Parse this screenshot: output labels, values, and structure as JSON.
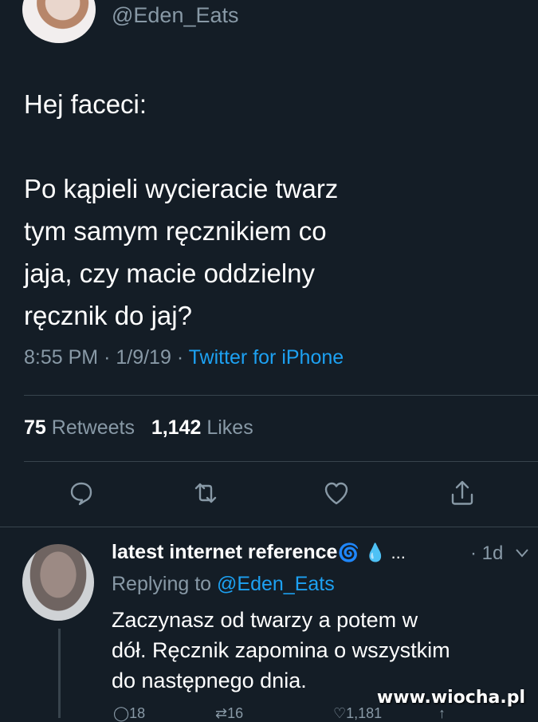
{
  "author": {
    "handle": "@Eden_Eats"
  },
  "tweet": {
    "lines": [
      "Hej faceci:",
      "",
      "Po kąpieli wycieracie twarz",
      "tym samym ręcznikiem co",
      "jaja, czy macie oddzielny",
      "ręcznik do jaj?"
    ],
    "time": "8:55 PM",
    "date": "1/9/19",
    "source": "Twitter for iPhone",
    "retweets_count": "75",
    "retweets_label": "Retweets",
    "likes_count": "1,142",
    "likes_label": "Likes"
  },
  "actions": {
    "icons": [
      "reply-icon",
      "retweet-icon",
      "like-icon",
      "share-icon"
    ]
  },
  "reply": {
    "name": "latest internet reference",
    "emojis": "🌀 💧 ...",
    "age": "· 1d",
    "replying_prefix": "Replying to",
    "replying_to": "@Eden_Eats",
    "text_lines": [
      "Zaczynasz od twarzy a potem w",
      "dół. Ręcznik zapomina o wszystkim",
      "do następnego dnia."
    ],
    "reply_count": "18",
    "retweet_count": "16",
    "like_count": "1,181"
  },
  "watermark": "www.wiocha.pl",
  "colors": {
    "background": "#141d26",
    "muted": "#8899a6",
    "link": "#1da1f2",
    "divider": "#38444d"
  }
}
